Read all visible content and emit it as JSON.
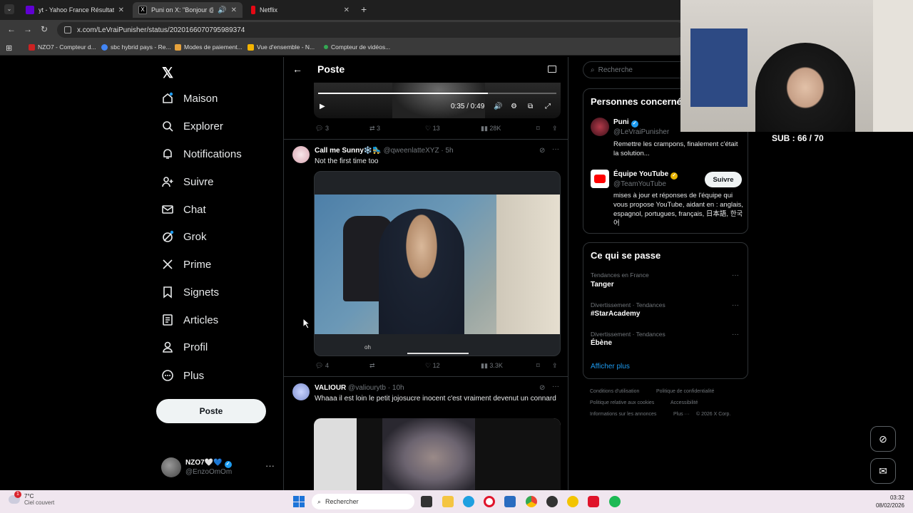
{
  "browser": {
    "tabs": [
      {
        "title": "yt - Yahoo France Résultats de la",
        "favicon_color": "#6001d2"
      },
      {
        "title": "Puni on X: \"Bonjour @TeamYo",
        "favicon_color": "#000000"
      },
      {
        "title": "Netflix",
        "favicon_color": "#e50914"
      }
    ],
    "url": "x.com/LeVraiPunisher/status/2020166070795989374",
    "bookmarks": [
      {
        "label": "NZO7 - Compteur d...",
        "color": "#cc2222"
      },
      {
        "label": "sbc hybrid pays - Re...",
        "color": "#4285f4"
      },
      {
        "label": "Modes de paiement...",
        "color": "#e6a23c"
      },
      {
        "label": "Vue d'ensemble - N...",
        "color": "#f4b400"
      },
      {
        "label": "Compteur de vidéos...",
        "color": "#34a853"
      }
    ]
  },
  "sidebar": {
    "items": [
      {
        "label": "Maison",
        "icon": "home-icon"
      },
      {
        "label": "Explorer",
        "icon": "search-icon"
      },
      {
        "label": "Notifications",
        "icon": "bell-icon"
      },
      {
        "label": "Suivre",
        "icon": "follow-icon"
      },
      {
        "label": "Chat",
        "icon": "mail-icon"
      },
      {
        "label": "Grok",
        "icon": "grok-icon"
      },
      {
        "label": "Prime",
        "icon": "x-icon"
      },
      {
        "label": "Signets",
        "icon": "bookmark-icon"
      },
      {
        "label": "Articles",
        "icon": "article-icon"
      },
      {
        "label": "Profil",
        "icon": "person-icon"
      },
      {
        "label": "Plus",
        "icon": "more-circle-icon"
      }
    ],
    "post_button": "Poste",
    "account": {
      "name": "NZO7🤍💙",
      "handle": "@EnzoOmOm",
      "more": "···"
    }
  },
  "timeline": {
    "header": "Poste",
    "video": {
      "time": "0:35 / 0:49",
      "progress": 0.714
    },
    "first_actions": {
      "replies": "3",
      "reposts": "3",
      "likes": "13",
      "views": "28K"
    },
    "tweets": [
      {
        "name": "Call me Sunny❄️🛼",
        "handle": "@qweenlatteXYZ · 5h",
        "text": "Not the first time too",
        "caption": "oh",
        "actions": {
          "replies": "4",
          "reposts": "",
          "likes": "12",
          "views": "3.3K"
        }
      },
      {
        "name": "VALIOUR",
        "handle": "@valiourytb · 10h",
        "text": "Whaaa il est loin le petit jojosucre inocent c'est vraiment devenut un connard"
      }
    ]
  },
  "right": {
    "search_placeholder": "Recherche",
    "people_title": "Personnes concernées",
    "people": [
      {
        "name": "Puni",
        "handle": "@LeVraiPunisher",
        "bio": "Remettre les crampons, finalement c'était la solution...",
        "verified_color": "#1d9bf0"
      },
      {
        "name": "Équipe YouTube",
        "handle": "@TeamYouTube",
        "bio": "mises à jour et réponses de l'équipe qui vous propose YouTube, aidant en : anglais, espagnol, portugues, français, 日本語, 한국어",
        "follow": "Suivre",
        "verified_color": "#e8b400"
      }
    ],
    "trends_title": "Ce qui se passe",
    "trends": [
      {
        "category": "Tendances en France",
        "name": "Tanger"
      },
      {
        "category": "Divertissement · Tendances",
        "name": "#StarAcademy"
      },
      {
        "category": "Divertissement · Tendances",
        "name": "Ébène"
      }
    ],
    "show_more": "Afficher plus",
    "footer": [
      "Conditions d'utilisation",
      "Politique de confidentialité",
      "Politique relative aux cookies",
      "Accessibilité",
      "Informations sur les annonces",
      "Plus ···",
      "© 2026 X Corp."
    ],
    "accent": "#1d9bf0"
  },
  "overlay": {
    "sub_counter": "SUB : 66 / 70"
  },
  "taskbar": {
    "weather_temp": "7°C",
    "weather_desc": "Ciel couvert",
    "weather_badge": "1",
    "search": "Rechercher",
    "time": "03:32",
    "date": "08/02/2026"
  }
}
